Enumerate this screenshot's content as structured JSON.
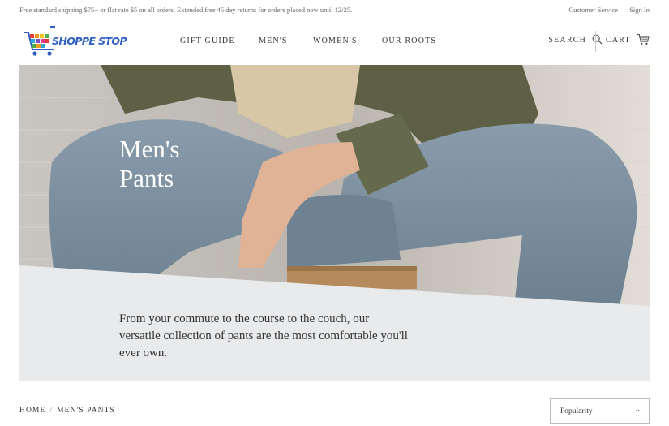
{
  "topbar": {
    "promo": "Free standard shipping $75+ or flat rate $5 on all orders. Extended free 45 day returns for orders placed now until 12/25.",
    "customer_service": "Customer Service",
    "sign_in": "Sign In"
  },
  "brand": {
    "logo_text": "SHOPPE STOP"
  },
  "nav": {
    "items": [
      "GIFT GUIDE",
      "MEN'S",
      "WOMEN'S",
      "OUR ROOTS"
    ],
    "search_label": "SEARCH",
    "cart_label": "CART"
  },
  "hero": {
    "title_line1": "Men's",
    "title_line2": "Pants",
    "description": "From your commute to the course to the couch, our versatile collection of pants are the most comfortable you'll ever own."
  },
  "breadcrumb": {
    "home": "HOME",
    "separator": "/",
    "current": "MEN'S PANTS"
  },
  "sort": {
    "selected": "Popularity"
  },
  "colors": {
    "accent_blue": "#2f5fc4",
    "hero_panel": "#e9eaec"
  }
}
